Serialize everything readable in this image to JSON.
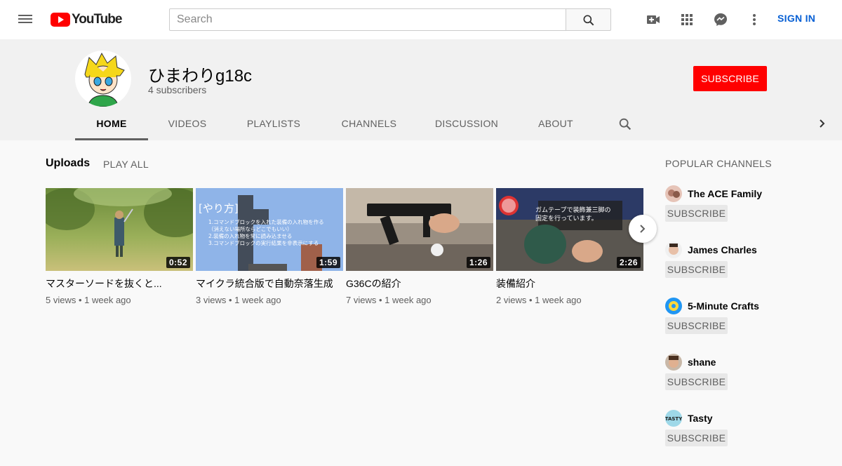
{
  "masthead": {
    "logo_text": "YouTube",
    "search_placeholder": "Search",
    "sign_in": "SIGN IN"
  },
  "channel": {
    "name": "ひまわりg18c",
    "subscribers": "4 subscribers",
    "subscribe_label": "SUBSCRIBE",
    "tabs": [
      {
        "label": "HOME",
        "active": true
      },
      {
        "label": "VIDEOS"
      },
      {
        "label": "PLAYLISTS"
      },
      {
        "label": "CHANNELS"
      },
      {
        "label": "DISCUSSION"
      },
      {
        "label": "ABOUT"
      }
    ]
  },
  "uploads": {
    "title": "Uploads",
    "play_all": "PLAY ALL",
    "videos": [
      {
        "title": "マスターソードを抜くと...",
        "views": "5 views",
        "age": "1 week ago",
        "duration": "0:52"
      },
      {
        "title": "マイクラ統合版で自動奈落生成",
        "views": "3 views",
        "age": "1 week ago",
        "duration": "1:59",
        "thumb_text": [
          "[やり方]",
          "1.コマンドブロックを入れた装備の入れ物を作る",
          "（消えない場所ならどこでもいい）",
          "2.装備の入れ物を常に読み込ませる",
          "3.コマンドブロックの実行結果を非表示にする"
        ]
      },
      {
        "title": "G36Cの紹介",
        "views": "7 views",
        "age": "1 week ago",
        "duration": "1:26"
      },
      {
        "title": "装備紹介",
        "views": "2 views",
        "age": "1 week ago",
        "duration": "2:26",
        "thumb_text": [
          "ガムテープで装飾兼三脚の",
          "固定を行っています。"
        ]
      }
    ]
  },
  "popular": {
    "title": "POPULAR CHANNELS",
    "subscribe_label": "SUBSCRIBE",
    "channels": [
      {
        "name": "The ACE Family"
      },
      {
        "name": "James Charles"
      },
      {
        "name": "5-Minute Crafts"
      },
      {
        "name": "shane"
      },
      {
        "name": "Tasty",
        "avatar_text": "TASTY"
      }
    ]
  },
  "colors": {
    "brand_red": "#ff0000",
    "link_blue": "#065fd4",
    "header_bg": "#f1f1f1"
  }
}
